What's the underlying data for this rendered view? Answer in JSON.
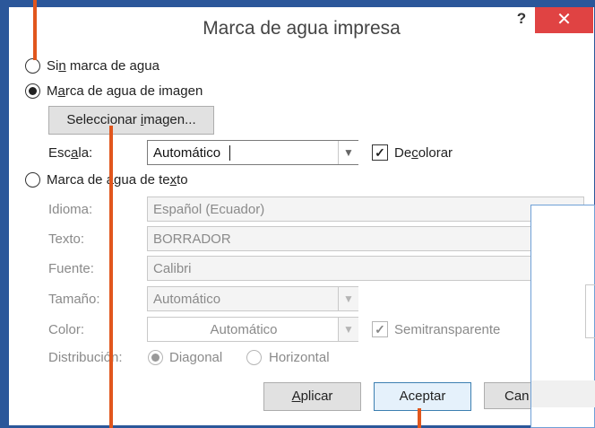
{
  "dialog": {
    "title": "Marca de agua impresa",
    "help_label": "?",
    "close_label": "✕"
  },
  "options": {
    "no_watermark": {
      "pre": "Si",
      "key": "n",
      "post": " marca de agua",
      "selected": false
    },
    "image_watermark": {
      "pre": "M",
      "key": "a",
      "post": "rca de agua de imagen",
      "selected": true
    },
    "text_watermark": {
      "pre": "Marca de agua de te",
      "key": "x",
      "post": "to",
      "selected": false
    }
  },
  "image_section": {
    "select_button": {
      "pre": "Seleccionar ",
      "key": "i",
      "post": "magen..."
    },
    "scale_label": {
      "pre": "Esc",
      "key": "a",
      "post": "la:"
    },
    "scale_value": "Automático",
    "decolor": {
      "pre": "De",
      "key": "c",
      "post": "olorar",
      "checked": true
    }
  },
  "text_section": {
    "language": {
      "label": "Idioma:",
      "value": "Español (Ecuador)"
    },
    "text": {
      "label": "Texto:",
      "value": "BORRADOR"
    },
    "font": {
      "label": "Fuente:",
      "value": "Calibri"
    },
    "size": {
      "label": "Tamaño:",
      "value": "Automático"
    },
    "color": {
      "label": "Color:",
      "value": "Automático"
    },
    "semitransparent": {
      "label": "Semitransparente",
      "checked": true
    },
    "layout": {
      "label": "Distribución:",
      "diagonal": "Diagonal",
      "horizontal": "Horizontal",
      "selected": "Diagonal"
    }
  },
  "buttons": {
    "apply": {
      "key": "A",
      "post": "plicar"
    },
    "accept": "Aceptar",
    "cancel": "Can"
  },
  "colors": {
    "accent_blue": "#2b579a",
    "close_red": "#e04343",
    "pointer_orange": "#e1561d"
  }
}
